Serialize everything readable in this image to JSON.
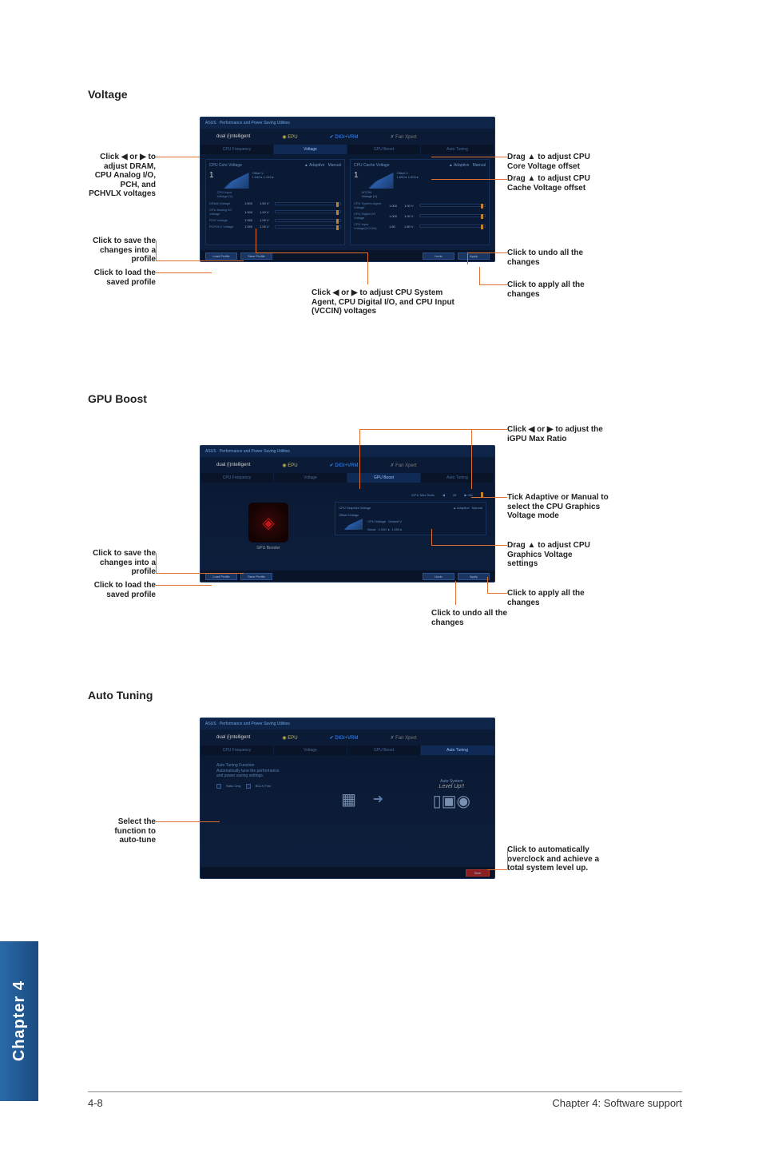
{
  "sections": {
    "voltage": {
      "title": "Voltage"
    },
    "gpu": {
      "title": "GPU Boost"
    },
    "auto": {
      "title": "Auto Tuning"
    }
  },
  "voltage_callouts": {
    "left1": "Click ◀ or ▶ to adjust DRAM, CPU Analog I/O, PCH, and PCHVLX voltages",
    "left2": "Click to save the changes into a profile",
    "left3": "Click to load the saved profile",
    "bottom": "Click ◀ or ▶ to  adjust CPU System Agent, CPU Digital I/O, and CPU Input (VCCIN) voltages",
    "right1": "Drag ▲ to adjust CPU Core Voltage offset",
    "right2": "Drag ▲ to adjust CPU Cache Voltage offset",
    "right3": "Click to undo all the changes",
    "right4": "Click to apply all the changes"
  },
  "gpu_callouts": {
    "left1": "Click to save the changes into a profile",
    "left2": "Click to load the saved profile",
    "bottom": "Click to undo all the changes",
    "right1": "Click ◀ or ▶ to adjust the iGPU Max Ratio",
    "right2": "Tick Adaptive or Manual to select the CPU Graphics Voltage mode",
    "right3": "Drag ▲ to adjust CPU Graphics Voltage settings",
    "right4": "Click to apply all the changes"
  },
  "auto_callouts": {
    "left": "Select the function to auto-tune",
    "right": "Click to automatically overclock and achieve a total system level up."
  },
  "ui": {
    "level_up": "Level Up!!",
    "gpu_booster": "GPU Booster"
  },
  "chapter_tab": "Chapter 4",
  "footer": {
    "left": "4-8",
    "right": "Chapter 4: Software support"
  }
}
